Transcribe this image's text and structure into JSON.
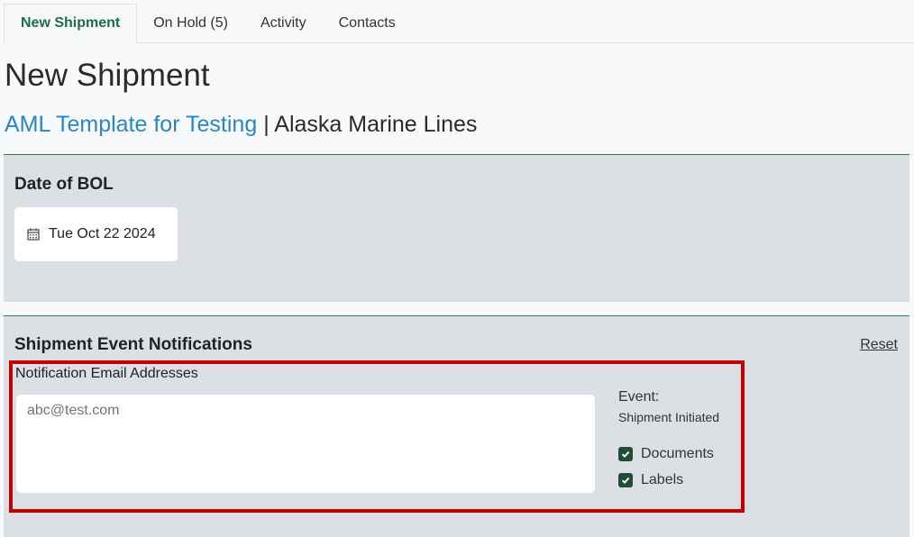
{
  "tabs": [
    {
      "label": "New Shipment"
    },
    {
      "label": "On Hold (5)"
    },
    {
      "label": "Activity"
    },
    {
      "label": "Contacts"
    }
  ],
  "page": {
    "title": "New Shipment",
    "template_link": "AML Template for Testing",
    "separator": "|",
    "carrier": "Alaska Marine Lines"
  },
  "bol_date": {
    "section_title": "Date of BOL",
    "value": "Tue Oct 22 2024",
    "icon": "calendar-icon"
  },
  "notifications": {
    "section_title": "Shipment Event Notifications",
    "reset_label": "Reset",
    "email_label": "Notification Email Addresses",
    "email_placeholder": "abc@test.com",
    "event_label": "Event:",
    "event_value": "Shipment Initiated",
    "options": [
      {
        "label": "Documents",
        "checked": true
      },
      {
        "label": "Labels",
        "checked": true
      }
    ]
  },
  "colors": {
    "accent_green": "#1f6b4a",
    "link_blue": "#2b86c6",
    "highlight_red": "#c00000",
    "section_bg": "#dcdfe3"
  }
}
